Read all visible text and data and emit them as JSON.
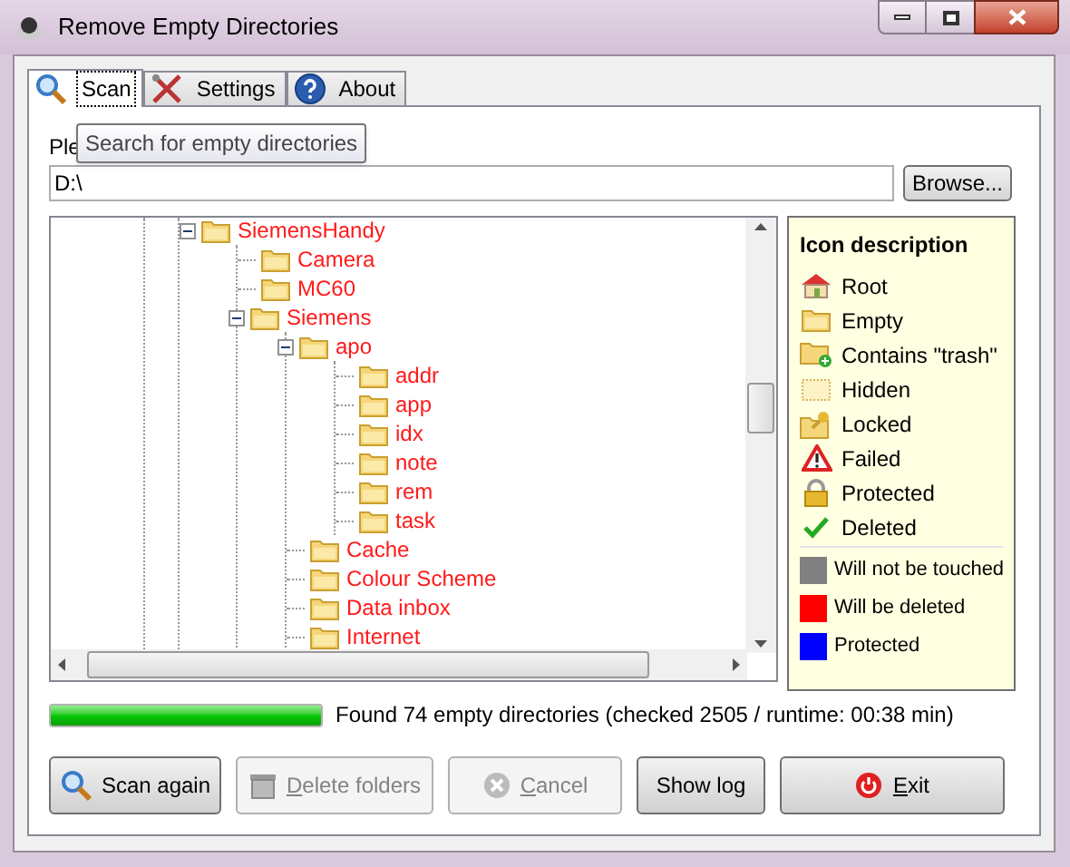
{
  "window": {
    "title": "Remove Empty Directories"
  },
  "tabs": [
    {
      "label": "Scan",
      "kind": "search",
      "selected": true
    },
    {
      "label": "Settings",
      "kind": "tools",
      "selected": false
    },
    {
      "label": "About",
      "kind": "help",
      "selected": false
    }
  ],
  "path": {
    "label": "Ple",
    "value": "D:\\",
    "browse": "Browse..."
  },
  "tooltip": "Search for empty directories",
  "tree": [
    {
      "label": "SiemensHandy",
      "expanded": true,
      "children": [
        {
          "label": "Camera"
        },
        {
          "label": "MC60"
        },
        {
          "label": "Siemens",
          "expanded": true,
          "children": [
            {
              "label": "apo",
              "expanded": true,
              "children": [
                {
                  "label": "addr"
                },
                {
                  "label": "app"
                },
                {
                  "label": "idx"
                },
                {
                  "label": "note"
                },
                {
                  "label": "rem"
                },
                {
                  "label": "task"
                }
              ]
            },
            {
              "label": "Cache"
            },
            {
              "label": "Colour Scheme"
            },
            {
              "label": "Data inbox"
            },
            {
              "label": "Internet"
            }
          ]
        }
      ]
    }
  ],
  "legend": {
    "title": "Icon description",
    "icons": [
      {
        "kind": "root",
        "label": "Root"
      },
      {
        "kind": "empty",
        "label": "Empty"
      },
      {
        "kind": "trash",
        "label": "Contains \"trash\""
      },
      {
        "kind": "hidden",
        "label": "Hidden"
      },
      {
        "kind": "locked",
        "label": "Locked"
      },
      {
        "kind": "failed",
        "label": "Failed"
      },
      {
        "kind": "protected",
        "label": "Protected"
      },
      {
        "kind": "deleted",
        "label": "Deleted"
      }
    ],
    "colors": [
      {
        "color": "#808080",
        "label": "Will not be touched"
      },
      {
        "color": "#ff0000",
        "label": "Will be deleted"
      },
      {
        "color": "#0000ff",
        "label": "Protected"
      }
    ]
  },
  "progress": {
    "level": 1,
    "text": "Found 74 empty directories (checked 2505 / runtime: 00:38 min)"
  },
  "buttons": [
    {
      "kind": "search",
      "label": "Scan again",
      "disabled": false,
      "mnemonic": false
    },
    {
      "kind": "bin",
      "label": "Delete folders",
      "disabled": true,
      "mnemonic": true
    },
    {
      "kind": "cancel",
      "label": "Cancel",
      "disabled": true,
      "mnemonic": true
    },
    {
      "kind": "plain",
      "label": "Show log",
      "disabled": false,
      "mnemonic": false
    },
    {
      "kind": "power",
      "label": "Exit",
      "disabled": false,
      "mnemonic": true
    }
  ]
}
